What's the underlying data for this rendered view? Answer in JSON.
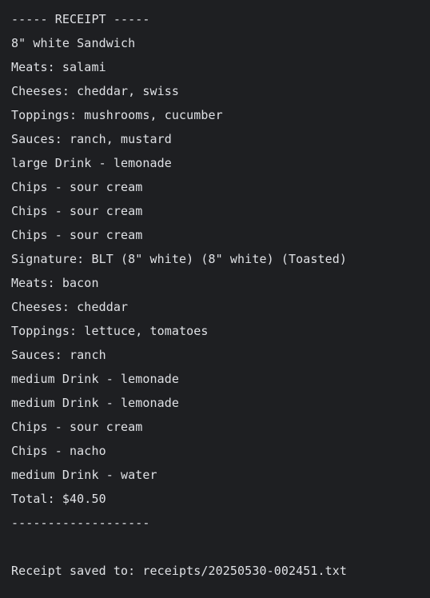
{
  "console": {
    "lines": [
      "----- RECEIPT -----",
      "8\" white Sandwich",
      "Meats: salami",
      "Cheeses: cheddar, swiss",
      "Toppings: mushrooms, cucumber",
      "Sauces: ranch, mustard",
      "large Drink - lemonade",
      "Chips - sour cream",
      "Chips - sour cream",
      "Chips - sour cream",
      "Signature: BLT (8\" white) (8\" white) (Toasted)",
      "Meats: bacon",
      "Cheeses: cheddar",
      "Toppings: lettuce, tomatoes",
      "Sauces: ranch",
      "medium Drink - lemonade",
      "medium Drink - lemonade",
      "Chips - sour cream",
      "Chips - nacho",
      "medium Drink - water",
      "Total: $40.50",
      "-------------------",
      "",
      "Receipt saved to: receipts/20250530-002451.txt"
    ]
  },
  "colors": {
    "background": "#1e1f22",
    "text": "#dfe1e5"
  }
}
